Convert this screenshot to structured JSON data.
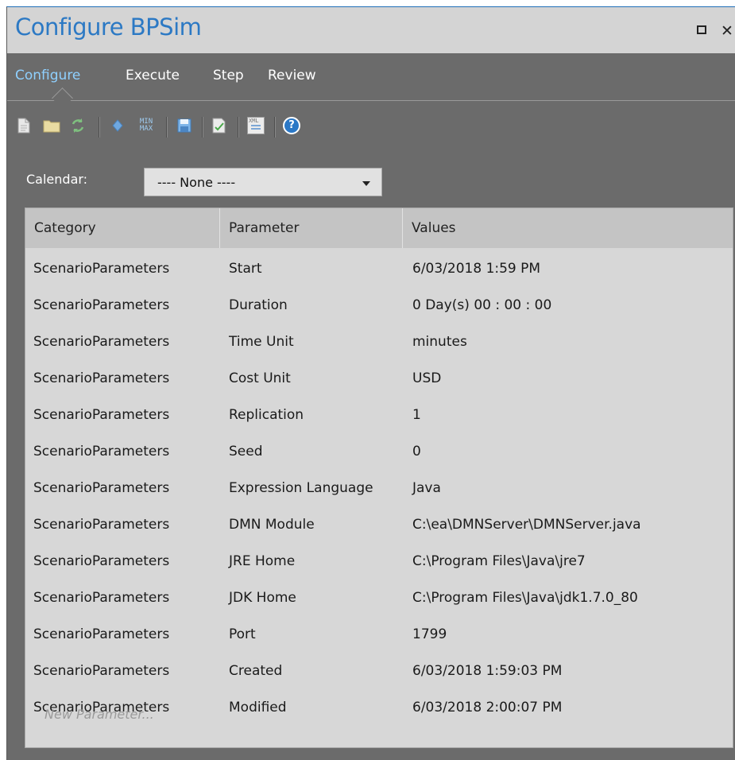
{
  "window": {
    "title": "Configure BPSim",
    "close_glyph": "✕"
  },
  "tabs": [
    {
      "label": "Configure",
      "active": true
    },
    {
      "label": "Execute",
      "active": false
    },
    {
      "label": "Step",
      "active": false
    },
    {
      "label": "Review",
      "active": false
    }
  ],
  "toolbar": {
    "icons": [
      "new-document-icon",
      "open-folder-icon",
      "refresh-icon",
      "diamond-icon",
      "min-max-icon",
      "save-icon",
      "validate-icon",
      "xml-export-icon",
      "help-icon"
    ],
    "minmax_top": "MIN",
    "minmax_bottom": "MAX",
    "xml_text": "XML",
    "help_glyph": "?"
  },
  "calendar": {
    "label": "Calendar:",
    "selected": "---- None ----"
  },
  "table": {
    "columns": [
      "Category",
      "Parameter",
      "Values"
    ],
    "rows": [
      {
        "category": "ScenarioParameters",
        "parameter": "Start",
        "value": "6/03/2018 1:59 PM"
      },
      {
        "category": "ScenarioParameters",
        "parameter": "Duration",
        "value": "0 Day(s) 00 : 00 : 00"
      },
      {
        "category": "ScenarioParameters",
        "parameter": "Time Unit",
        "value": "minutes"
      },
      {
        "category": "ScenarioParameters",
        "parameter": "Cost Unit",
        "value": "USD"
      },
      {
        "category": "ScenarioParameters",
        "parameter": "Replication",
        "value": "1"
      },
      {
        "category": "ScenarioParameters",
        "parameter": "Seed",
        "value": "0"
      },
      {
        "category": "ScenarioParameters",
        "parameter": "Expression Language",
        "value": "Java"
      },
      {
        "category": "ScenarioParameters",
        "parameter": "DMN Module",
        "value": "C:\\ea\\DMNServer\\DMNServer.java"
      },
      {
        "category": "ScenarioParameters",
        "parameter": "JRE Home",
        "value": "C:\\Program Files\\Java\\jre7"
      },
      {
        "category": "ScenarioParameters",
        "parameter": "JDK Home",
        "value": "C:\\Program Files\\Java\\jdk1.7.0_80"
      },
      {
        "category": "ScenarioParameters",
        "parameter": "Port",
        "value": "1799"
      },
      {
        "category": "ScenarioParameters",
        "parameter": "Created",
        "value": "6/03/2018 1:59:03 PM"
      },
      {
        "category": "ScenarioParameters",
        "parameter": "Modified",
        "value": "6/03/2018 2:00:07 PM"
      }
    ],
    "new_row_placeholder": "New Parameter..."
  },
  "colors": {
    "title": "#2c79c4",
    "active_tab": "#8fd0ff",
    "panel_bg": "#6b6b6b",
    "grid_bg": "#d7d7d7",
    "header_bg": "#c4c4c4"
  }
}
